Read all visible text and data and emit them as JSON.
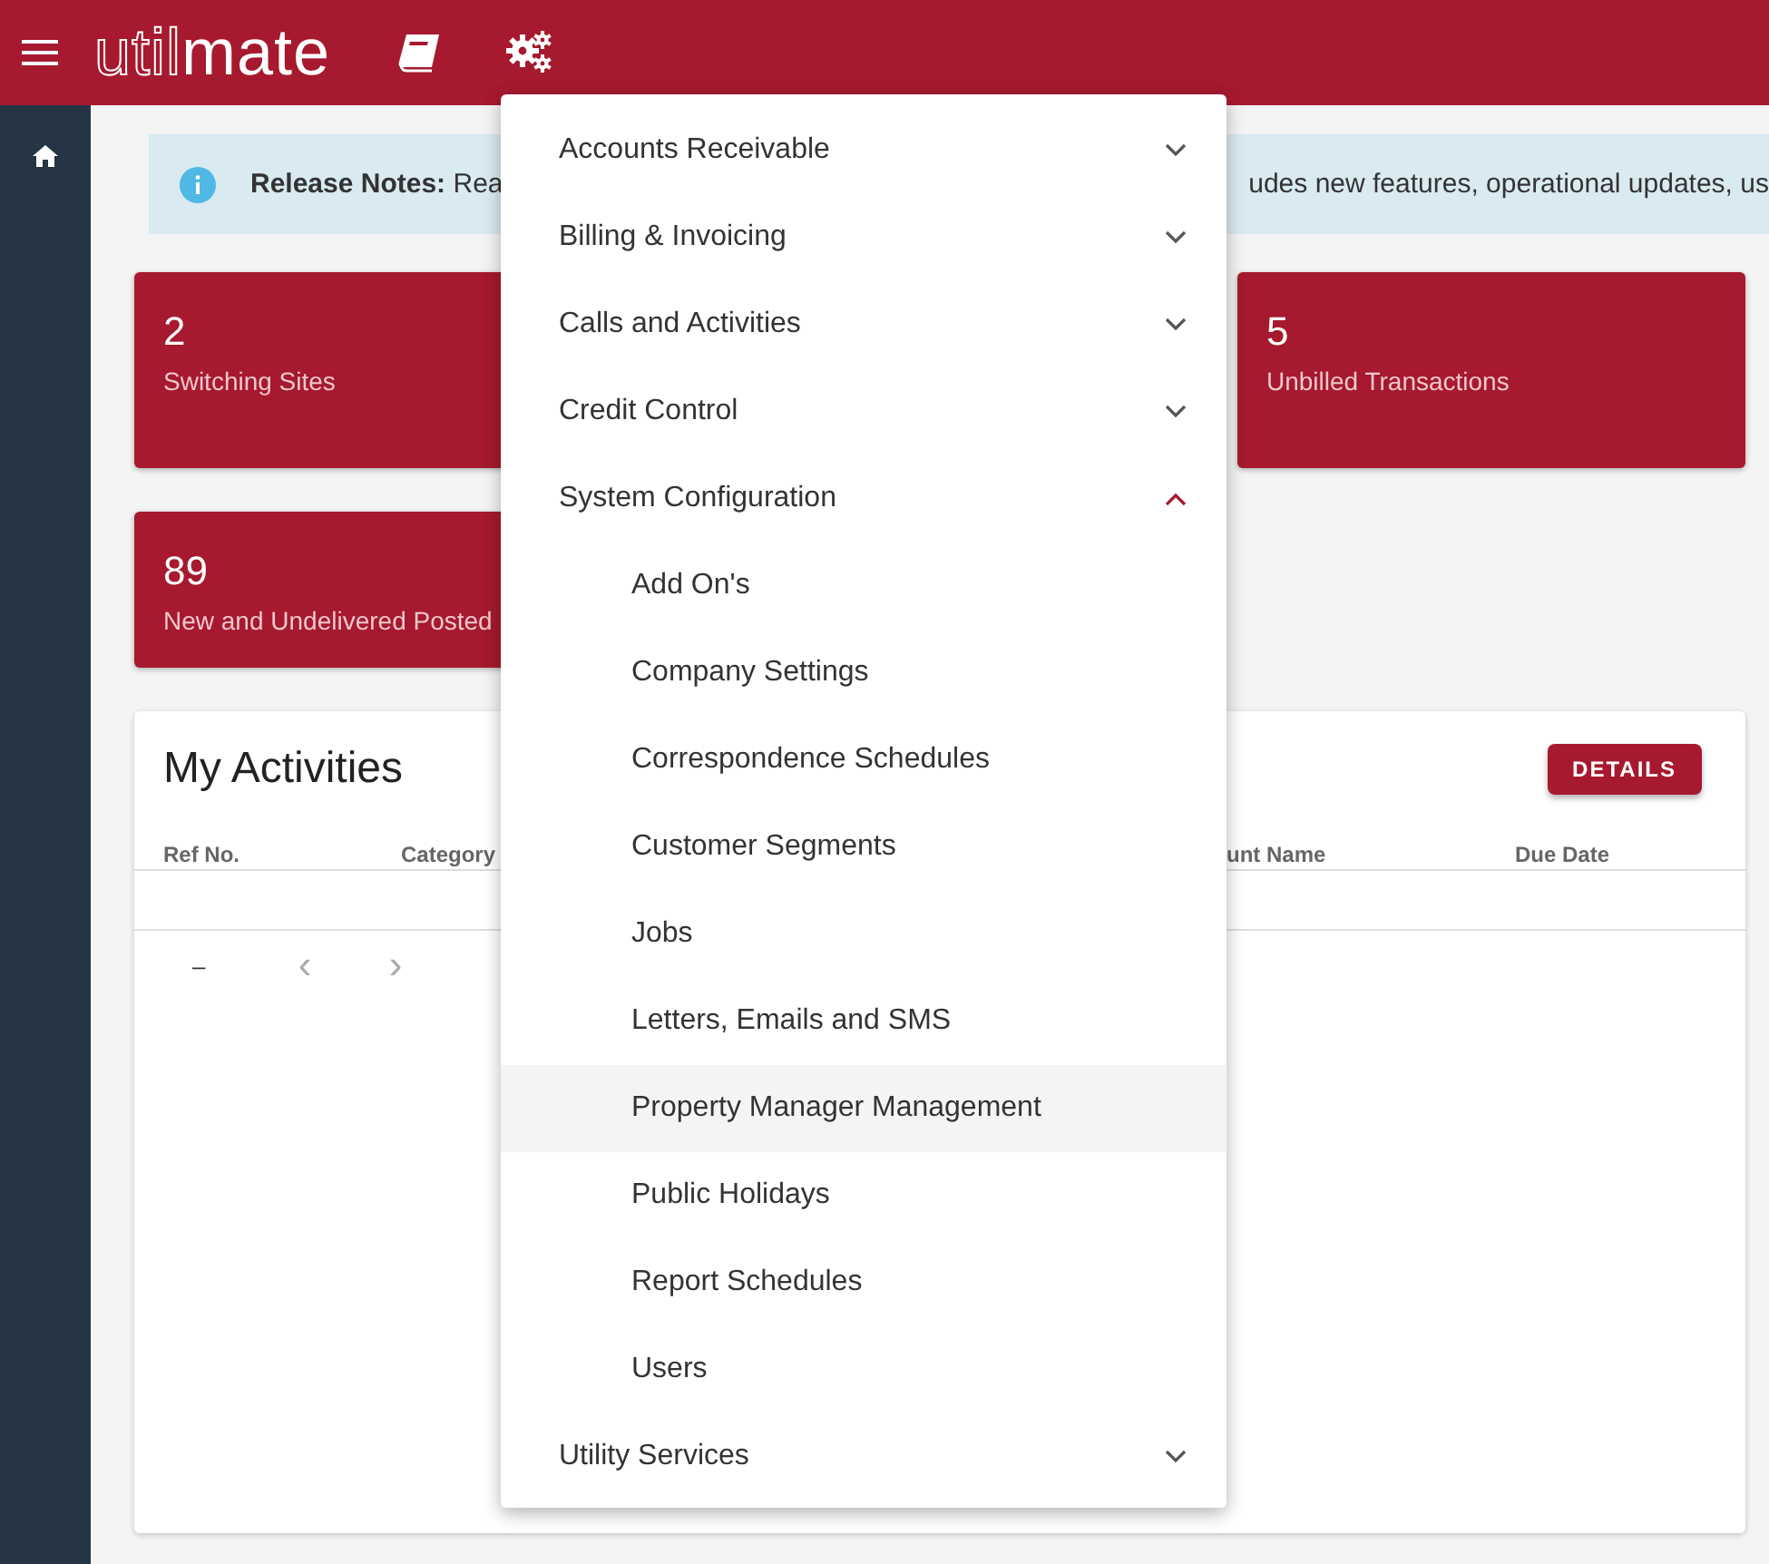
{
  "header": {
    "logo_outlined": "util",
    "logo_filled": "mate"
  },
  "banner": {
    "label": "Release Notes:",
    "text_start": "Rea",
    "text_end": "udes new features, operational updates, us"
  },
  "stat_cards": [
    {
      "value": "2",
      "label": "Switching Sites"
    },
    {
      "value": "5",
      "label": "Unbilled Transactions"
    },
    {
      "value": "89",
      "label": "New and Undelivered Posted"
    }
  ],
  "activities": {
    "title": "My Activities",
    "button": "DETAILS",
    "columns": [
      "Ref No.",
      "Category",
      "unt Name",
      "Due Date"
    ],
    "pagination": {
      "range": "–",
      "prev": "‹",
      "next": "›"
    }
  },
  "menu": [
    {
      "label": "Accounts Receivable",
      "expanded": false
    },
    {
      "label": "Billing & Invoicing",
      "expanded": false
    },
    {
      "label": "Calls and Activities",
      "expanded": false
    },
    {
      "label": "Credit Control",
      "expanded": false
    },
    {
      "label": "System Configuration",
      "expanded": true,
      "children": [
        {
          "label": "Add On's",
          "selected": false
        },
        {
          "label": "Company Settings",
          "selected": false
        },
        {
          "label": "Correspondence Schedules",
          "selected": false
        },
        {
          "label": "Customer Segments",
          "selected": false
        },
        {
          "label": "Jobs",
          "selected": false
        },
        {
          "label": "Letters, Emails and SMS",
          "selected": false
        },
        {
          "label": "Property Manager Management",
          "selected": true
        },
        {
          "label": "Public Holidays",
          "selected": false
        },
        {
          "label": "Report Schedules",
          "selected": false
        },
        {
          "label": "Users",
          "selected": false
        }
      ]
    },
    {
      "label": "Utility Services",
      "expanded": false
    }
  ]
}
